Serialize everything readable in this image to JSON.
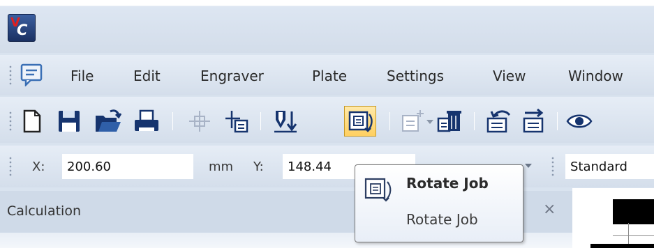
{
  "title_bar": {
    "logo_icon": "vc-app-logo"
  },
  "menu_bar": {
    "icon": "chat-window-icon",
    "items": [
      {
        "label": "File"
      },
      {
        "label": "Edit"
      },
      {
        "label": "Engraver"
      },
      {
        "label": "Plate"
      },
      {
        "label": "Settings"
      },
      {
        "label": "View"
      },
      {
        "label": "Window"
      }
    ]
  },
  "toolbar": {
    "icons": [
      "new-document-icon",
      "save-icon",
      "open-folder-icon",
      "print-icon",
      "snap-grid-icon",
      "move-origin-icon",
      "engrave-down-icon",
      "rotate-job-icon",
      "add-object-icon",
      "delete-object-icon",
      "undo-icon",
      "redo-icon",
      "preview-eye-icon"
    ],
    "active_icon": "rotate-job-icon"
  },
  "coord_bar": {
    "x_label": "X:",
    "x_value": "200.60",
    "x_unit": "mm",
    "y_label": "Y:",
    "y_value": "148.44",
    "style_value": "Standard"
  },
  "panel": {
    "title": "Calculation",
    "close_glyph": "×"
  },
  "tooltip": {
    "title": "Rotate Job",
    "description": "Rotate Job"
  },
  "colors": {
    "active_highlight": "#ffd061",
    "band_background": "#d4deeb",
    "accent_blue": "#2f5fa8"
  }
}
